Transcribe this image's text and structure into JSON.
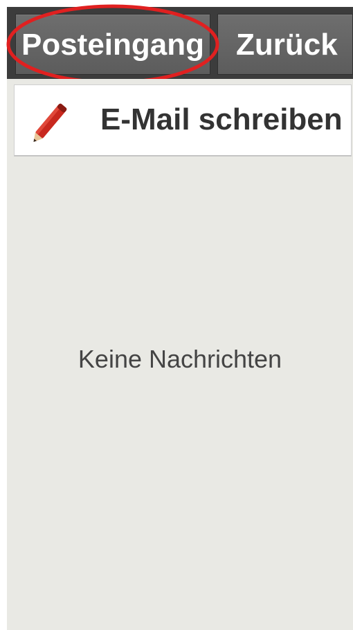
{
  "topbar": {
    "inbox_label": "Posteingang",
    "back_label": "Zurück"
  },
  "compose": {
    "label": "E-Mail schreiben",
    "icon": "pencil-icon"
  },
  "main": {
    "empty_message": "Keine Nachrichten"
  },
  "colors": {
    "topbar_bg": "#3c3c3c",
    "button_bg": "#666666",
    "content_bg": "#e9e9e4",
    "highlight": "#e02020",
    "pencil_red": "#c8281e"
  }
}
